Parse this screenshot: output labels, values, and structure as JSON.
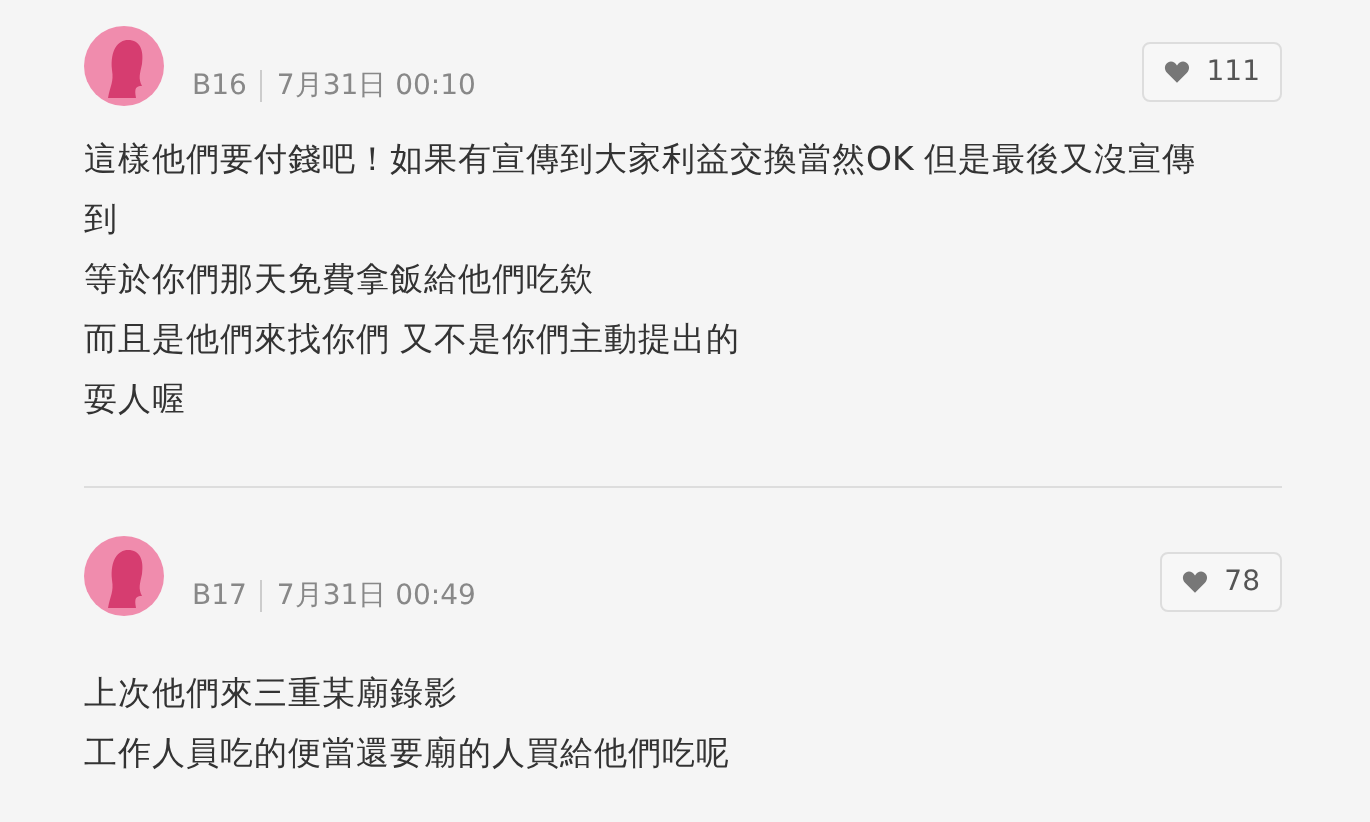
{
  "comments": [
    {
      "floor": "B16",
      "time": "7月31日 00:10",
      "likes": "111",
      "lines": [
        "這樣他們要付錢吧！如果有宣傳到大家利益交換當然OK 但是最後又沒宣傳到",
        "等於你們那天免費拿飯給他們吃欸",
        "而且是他們來找你們 又不是你們主動提出的",
        "耍人喔"
      ]
    },
    {
      "floor": "B17",
      "time": "7月31日 00:49",
      "likes": "78",
      "lines": [
        "上次他們來三重某廟錄影",
        "工作人員吃的便當還要廟的人買給他們吃呢"
      ]
    }
  ]
}
